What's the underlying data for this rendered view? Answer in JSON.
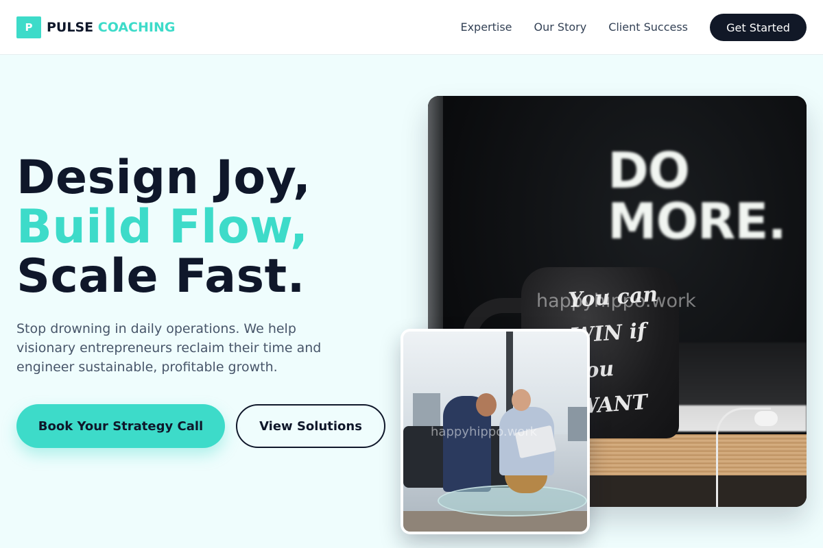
{
  "header": {
    "logo_mark": "P",
    "logo_word1": "PULSE",
    "logo_word2": "COACHING",
    "nav": [
      {
        "label": "Expertise"
      },
      {
        "label": "Our Story"
      },
      {
        "label": "Client Success"
      }
    ],
    "cta_label": "Get Started"
  },
  "hero": {
    "headline_line1": "Design Joy,",
    "headline_line2": "Build Flow,",
    "headline_line3": "Scale Fast.",
    "subtext": "Stop drowning in daily operations. We help visionary entrepreneurs reclaim their time and engineer sustainable, profitable growth.",
    "primary_button": "Book Your Strategy Call",
    "secondary_button": "View Solutions"
  },
  "images": {
    "main_sign_text": "DO MORE.",
    "mug_text": "You can WIN if you WANT",
    "watermark": "happyhippo.work",
    "overlay_watermark": "happyhippo.work"
  },
  "colors": {
    "accent": "#3ddbc9",
    "dark": "#0f172a",
    "background": "#effdfd",
    "button_dark": "#111827"
  }
}
